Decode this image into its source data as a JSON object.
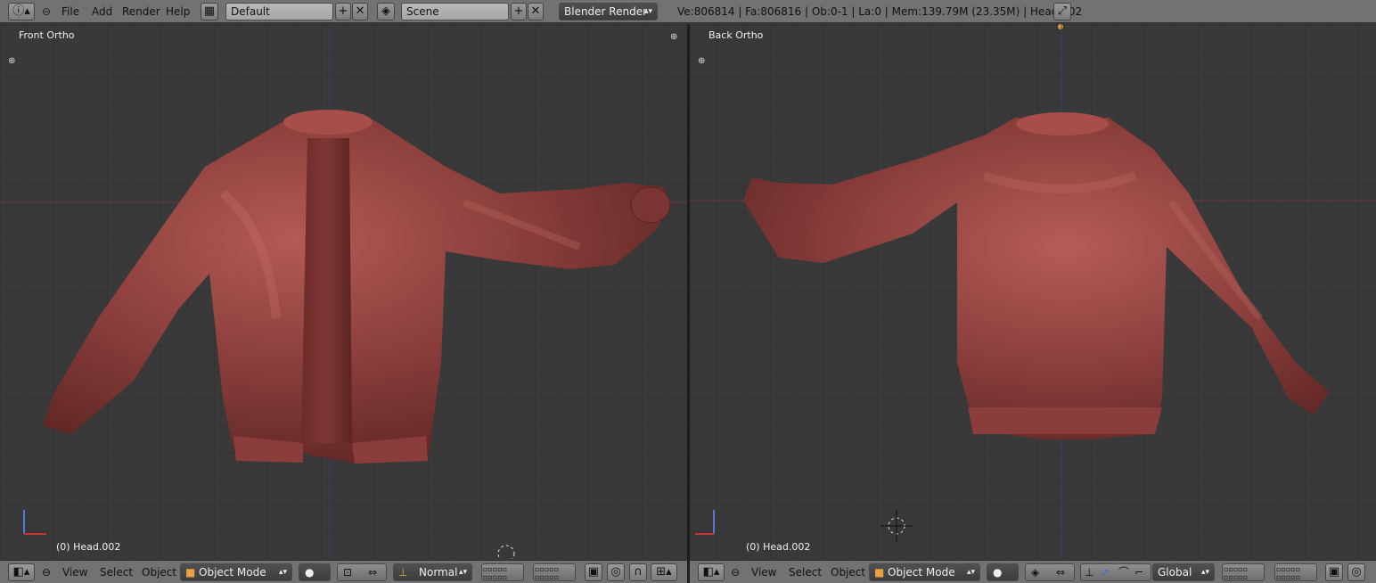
{
  "topbar": {
    "menus": [
      "File",
      "Add",
      "Render",
      "Help"
    ],
    "layout": "Default",
    "scene": "Scene",
    "engine": "Blender Render",
    "stats": "Ve:806814 | Fa:806816 | Ob:0-1 | La:0 | Mem:139.79M (23.35M) | Head.002"
  },
  "left_view": {
    "title": "Front Ortho",
    "object": "(0) Head.002",
    "header": {
      "menus": [
        "View",
        "Select",
        "Object"
      ],
      "mode": "Object Mode",
      "pivot": "Normal"
    }
  },
  "right_view": {
    "title": "Back Ortho",
    "object": "(0) Head.002",
    "header": {
      "menus": [
        "View",
        "Select",
        "Object"
      ],
      "mode": "Object Mode",
      "orientation": "Global"
    }
  },
  "colors": {
    "jacket": "#8c3f3c",
    "viewport": "#393939",
    "header": "#727272"
  }
}
